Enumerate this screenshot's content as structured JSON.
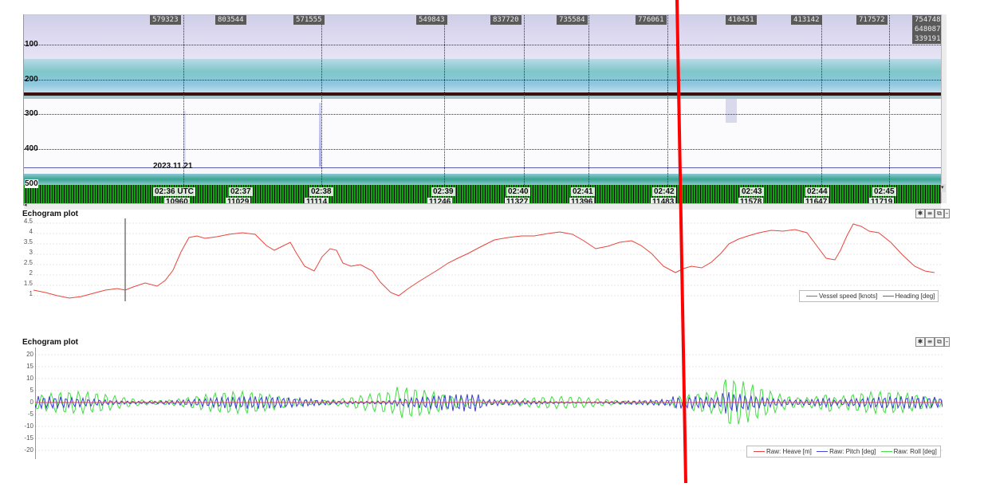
{
  "echogram": {
    "ping_labels": [
      "579323",
      "803544",
      "571555",
      "549843",
      "837720",
      "735584",
      "776061",
      "410451",
      "413142",
      "717572",
      "754748",
      "648087",
      "339191"
    ],
    "depth_labels": [
      "100",
      "200",
      "300",
      "400",
      "500"
    ],
    "date_label": "2023.11.21",
    "time_labels": [
      "02:36 UTC",
      "02:37",
      "02:38",
      "02:39",
      "02:40",
      "02:41",
      "02:42",
      "02:43",
      "02:44",
      "02:45"
    ],
    "ping_counts": [
      "10960",
      "11029",
      "11114",
      "11246",
      "11327",
      "11396",
      "11483",
      "11578",
      "11647",
      "11719"
    ]
  },
  "plot1": {
    "title": "Echogram plot",
    "y_ticks": [
      "4.5",
      "4",
      "3.5",
      "3",
      "2.5",
      "2",
      "1.5",
      "1"
    ],
    "legend": [
      {
        "label": "Vessel speed [knots]",
        "color": "#e8463c"
      },
      {
        "label": "Heading [deg]",
        "color": "#5a5ae8"
      }
    ]
  },
  "plot2": {
    "title": "Echogram plot",
    "y_ticks": [
      "20",
      "15",
      "10",
      "5",
      "0",
      "-5",
      "-10",
      "-15",
      "-20"
    ],
    "legend": [
      {
        "label": "Raw: Heave [m]",
        "color": "#e84646"
      },
      {
        "label": "Raw: Pitch [deg]",
        "color": "#4646e0"
      },
      {
        "label": "Raw: Roll [deg]",
        "color": "#46e046"
      }
    ]
  },
  "toolbar_icons": [
    "settings-icon",
    "list-icon",
    "window-icon",
    "minimize-icon"
  ]
}
